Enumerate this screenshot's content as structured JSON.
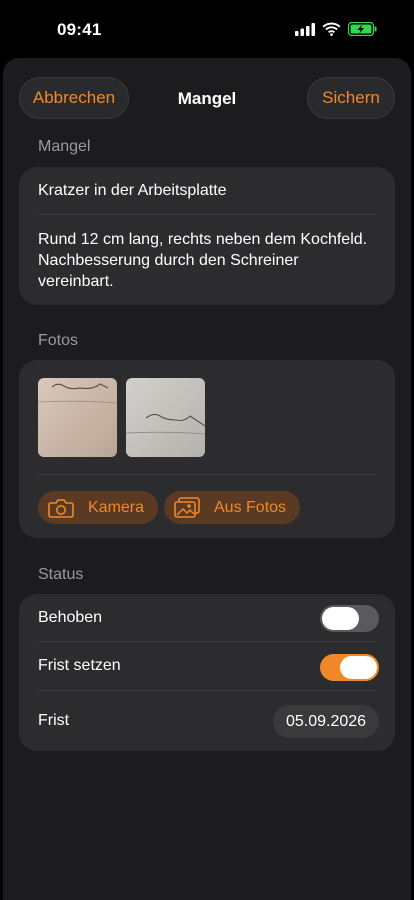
{
  "status_bar": {
    "time": "09:41"
  },
  "nav": {
    "cancel_label": "Abbrechen",
    "title": "Mangel",
    "save_label": "Sichern"
  },
  "defect": {
    "header": "Mangel",
    "title": "Kratzer in der Arbeitsplatte",
    "description": "Rund 12 cm lang, rechts neben dem Kochfeld. Nachbesserung durch den Schreiner vereinbart."
  },
  "photos": {
    "header": "Fotos",
    "thumbnails": [
      "photo-1",
      "photo-2"
    ],
    "camera_label": "Kamera",
    "library_label": "Aus Fotos"
  },
  "status": {
    "header": "Status",
    "fixed_label": "Behoben",
    "fixed_on": false,
    "deadline_toggle_label": "Frist setzen",
    "deadline_on": true,
    "deadline_label": "Frist",
    "deadline_value": "05.09.2026"
  },
  "colors": {
    "accent": "#f0882a",
    "background": "#1c1c1e",
    "card": "#2c2c2e"
  },
  "icons": [
    "signal-icon",
    "wifi-icon",
    "battery-charging-icon",
    "camera-icon",
    "photo-library-icon"
  ]
}
